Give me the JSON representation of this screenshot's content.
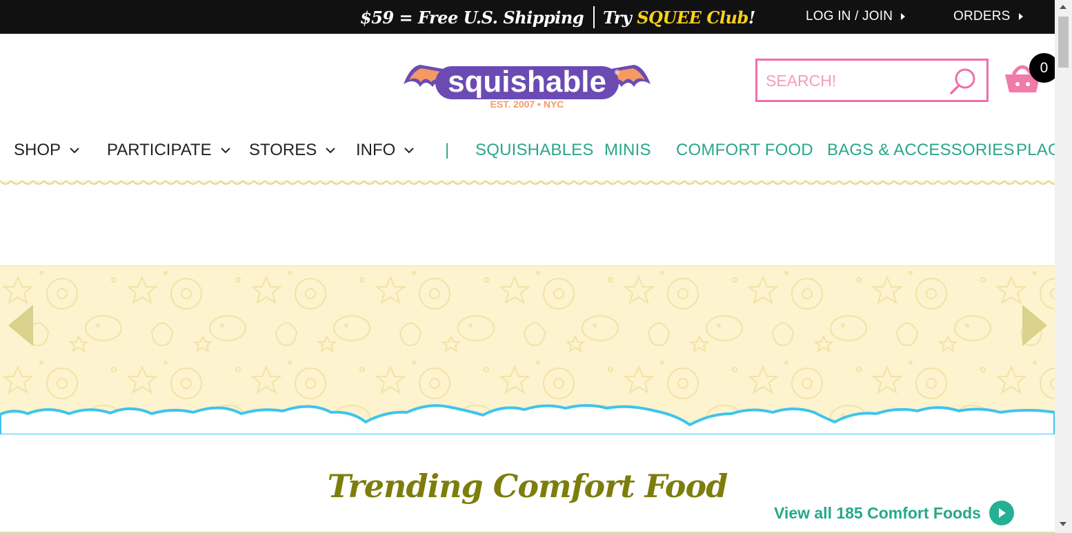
{
  "topbar": {
    "promo_shipping": "$59 = Free U.S. Shipping",
    "promo_try": "Try ",
    "promo_club": "SQUEE Club",
    "promo_bang": "!",
    "login_label": "LOG IN / JOIN",
    "orders_label": "ORDERS"
  },
  "header": {
    "logo_text": "squishable",
    "logo_tagline": "EST. 2007 • NYC",
    "search_placeholder": "SEARCH!",
    "cart_count": "0"
  },
  "nav": {
    "menus": [
      {
        "label": "SHOP"
      },
      {
        "label": "PARTICIPATE"
      },
      {
        "label": "STORES"
      },
      {
        "label": "INFO"
      }
    ],
    "divider": "|",
    "categories": [
      {
        "label": "SQUISHABLES"
      },
      {
        "label": "MINIS"
      },
      {
        "label": "COMFORT FOOD"
      },
      {
        "label": "BAGS & ACCESSORIES"
      },
      {
        "label": "PLAGUE"
      }
    ]
  },
  "trending": {
    "title": "Trending Comfort Food",
    "view_all": "View all 185 Comfort Foods"
  },
  "colors": {
    "topbar_bg": "#111111",
    "club_yellow": "#f9d21b",
    "nav_teal": "#2aa68a",
    "search_pink": "#ef6fa8",
    "logo_purple": "#6b4bb3",
    "logo_orange": "#f59a63",
    "banner_bg": "#fdf3ce",
    "cloud_blue": "#3ec4ee",
    "title_olive": "#7d7d0c"
  }
}
